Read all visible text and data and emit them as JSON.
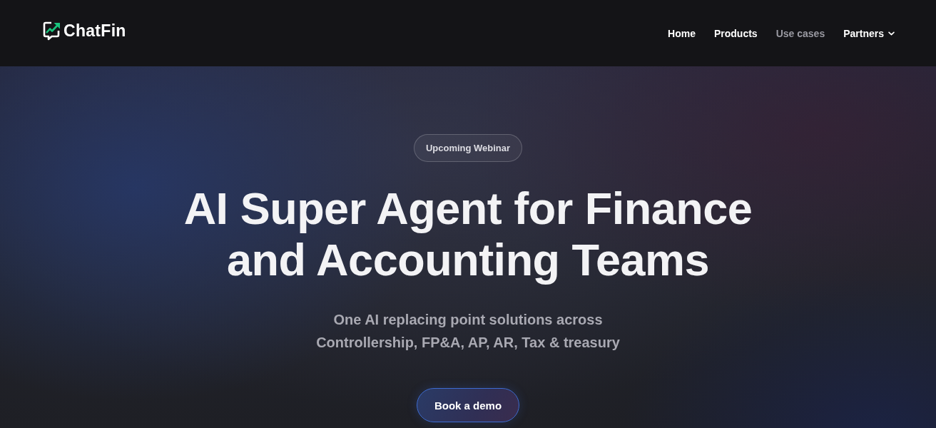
{
  "header": {
    "logo": {
      "text": "ChatFin"
    },
    "nav": [
      {
        "label": "Home",
        "selected": false,
        "kind": "link"
      },
      {
        "label": "Products",
        "selected": false,
        "kind": "link"
      },
      {
        "label": "Use cases",
        "selected": true,
        "kind": "link"
      },
      {
        "label": "Partners",
        "selected": false,
        "kind": "dropdown"
      }
    ]
  },
  "hero": {
    "badge": "Upcoming Webinar",
    "title_lines": [
      "AI Super Agent for Finance",
      "and Accounting Teams"
    ],
    "subtitle_lines": [
      "One AI replacing point solutions across",
      "Controllership, FP&A, AP, AR, Tax & treasury"
    ],
    "cta": "Book a demo"
  }
}
